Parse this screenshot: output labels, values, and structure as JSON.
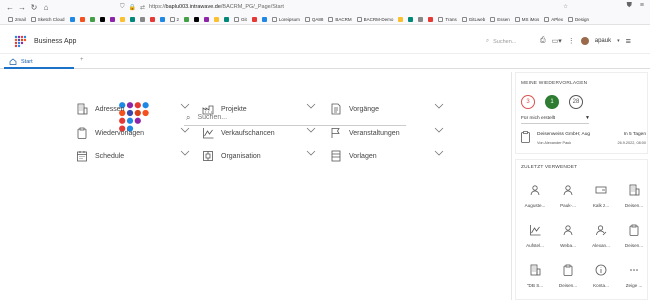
{
  "browser": {
    "url_prefix": "https://",
    "url_host": "baplu003.intrawave.de",
    "url_path": "/BACRM_PG/_Page/Start",
    "bookmarks": [
      "2mail",
      "Sketch Cloud",
      "",
      "",
      "",
      "",
      "",
      "",
      "",
      "",
      "",
      "",
      "2",
      "",
      "",
      "",
      "",
      "",
      "Git",
      "",
      "",
      "Loreipsum",
      "QA88",
      "BACRM",
      "BACRM-Demo",
      "",
      "",
      "",
      "",
      "Trans",
      "GitLweb",
      "Essen",
      "MS iMos",
      "APlex",
      "Design"
    ]
  },
  "app": {
    "name": "Business App",
    "search_placeholder": "Suchen...",
    "user_name": "apauk",
    "user_caret": "▾"
  },
  "tabs": {
    "start_label": "Start",
    "add_label": "+"
  },
  "main": {
    "search_placeholder": "Suchen...",
    "modules": [
      {
        "label": "Adressen",
        "icon": "building-icon"
      },
      {
        "label": "Projekte",
        "icon": "factory-icon"
      },
      {
        "label": "Vorgänge",
        "icon": "document-icon"
      },
      {
        "label": "Wiedervorlagen",
        "icon": "clipboard-icon"
      },
      {
        "label": "Verkaufschancen",
        "icon": "chart-icon"
      },
      {
        "label": "Veranstaltungen",
        "icon": "flag-icon"
      },
      {
        "label": "Schedule",
        "icon": "calendar-icon"
      },
      {
        "label": "Organisation",
        "icon": "org-icon"
      },
      {
        "label": "Vorlagen",
        "icon": "template-icon"
      }
    ]
  },
  "wiedervorlagen": {
    "title": "MEINE WIEDERVORLAGEN",
    "counts": [
      {
        "value": "3",
        "color": "#d9534f"
      },
      {
        "value": "1",
        "color": "#2e7d32"
      },
      {
        "value": "28",
        "color": "#555555"
      }
    ],
    "filter_label": "Für mich erstellt",
    "filter_arrow": "▼",
    "task": {
      "title": "Deisenweiss GmbH; Aug",
      "due": "In 5 Tagen",
      "by": "Von Alexander Pauk",
      "date": "26.9.2022, 08:00"
    }
  },
  "recent": {
    "title": "ZULETZT VERWENDET",
    "items": [
      {
        "label": "Auguste...",
        "icon": "person-icon"
      },
      {
        "label": "Pauk-...",
        "icon": "person-icon"
      },
      {
        "label": "Kalk z...",
        "icon": "card-icon"
      },
      {
        "label": "Deisen...",
        "icon": "building-icon"
      },
      {
        "label": "Aufstel...",
        "icon": "chart-icon"
      },
      {
        "label": "Weba...",
        "icon": "person-icon"
      },
      {
        "label": "Alexan...",
        "icon": "person-edit-icon"
      },
      {
        "label": "Deisen...",
        "icon": "clipboard-icon"
      },
      {
        "label": "\"DB S...",
        "icon": "building-icon"
      },
      {
        "label": "Deisen...",
        "icon": "clipboard-icon"
      },
      {
        "label": "Konta...",
        "icon": "info-icon"
      },
      {
        "label": "Zeige ...",
        "icon": "more-icon"
      }
    ]
  },
  "colors": {
    "accent": "#1a73c8",
    "logo_dots": [
      "#e53935",
      "#d84315",
      "#8e24aa",
      "#3949ab",
      "#1e88e5",
      "#f4511e"
    ]
  }
}
